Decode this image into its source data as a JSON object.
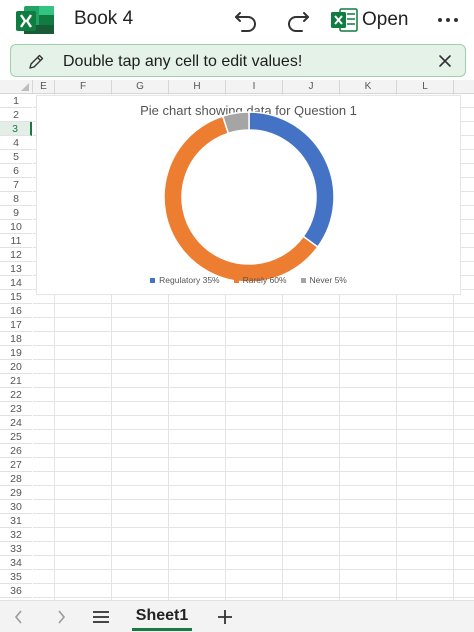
{
  "app": {
    "title": "Book 4",
    "logo_icon": "excel-logo-icon",
    "open_label": "Open",
    "brand_color": "#1d7044"
  },
  "banner": {
    "text": "Double tap any cell to edit values!",
    "background": "#e4f2e7"
  },
  "grid": {
    "columns": [
      "E",
      "F",
      "G",
      "H",
      "I",
      "J",
      "K",
      "L"
    ],
    "rows": [
      "1",
      "2",
      "3",
      "4",
      "5",
      "6",
      "7",
      "8",
      "9",
      "10",
      "11",
      "12",
      "13",
      "14",
      "15",
      "16",
      "17",
      "18",
      "19",
      "20",
      "21",
      "22",
      "23",
      "24",
      "25",
      "26",
      "27",
      "28",
      "29",
      "30",
      "31",
      "32",
      "33",
      "34",
      "35",
      "36"
    ],
    "active_row": "3"
  },
  "chart_data": {
    "type": "pie",
    "title": "Pie chart showing data for Question 1",
    "style": "doughnut",
    "series": [
      {
        "name": "Regulatory 35%",
        "value": 35,
        "color": "#4472c4"
      },
      {
        "name": "Rarely 60%",
        "value": 60,
        "color": "#ed7d31"
      },
      {
        "name": "Never 5%",
        "value": 5,
        "color": "#a5a5a5"
      }
    ],
    "legend_position": "bottom"
  },
  "bottom": {
    "sheet_tab": "Sheet1"
  }
}
